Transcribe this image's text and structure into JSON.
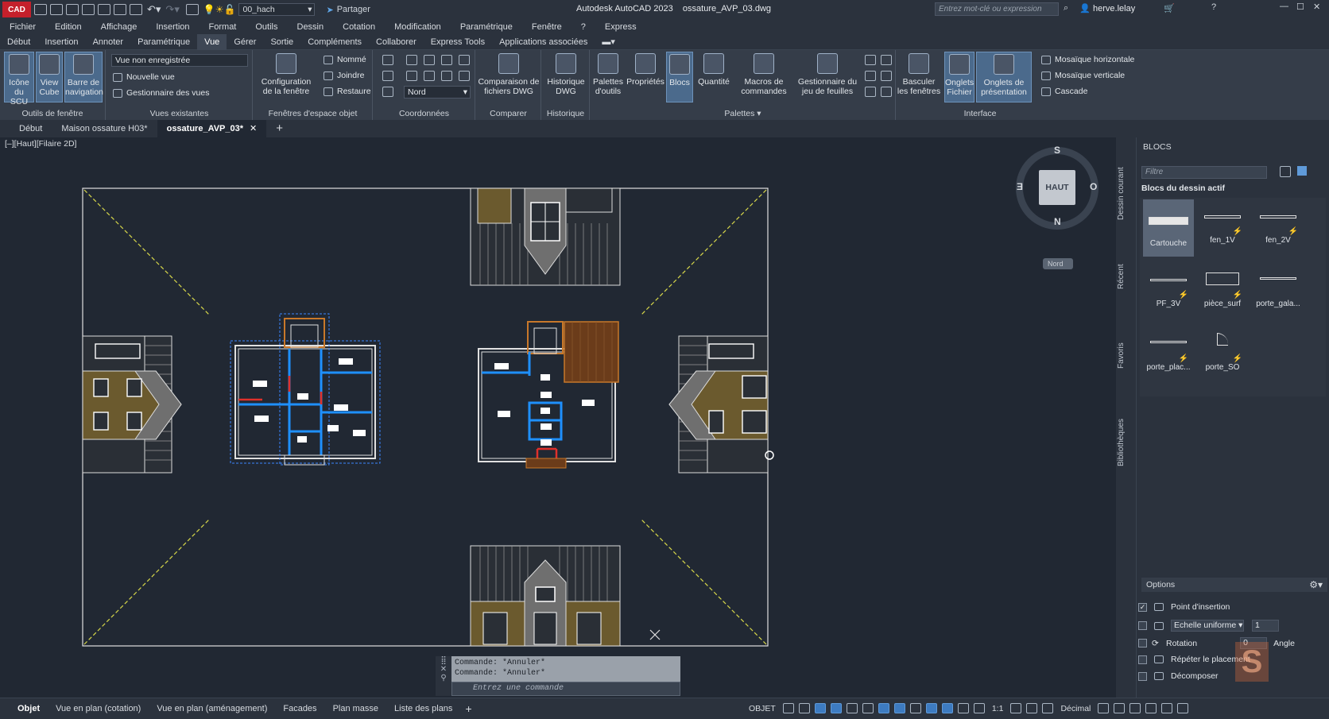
{
  "app": {
    "logo_text": "CAD",
    "window_title": "Autodesk AutoCAD 2023    ossature_AVP_03.dwg",
    "layer_combo": "00_hach",
    "share_label": "Partager",
    "search_placeholder": "Entrez mot-clé ou expression",
    "user_name": "herve.lelay"
  },
  "menu": [
    "Fichier",
    "Edition",
    "Affichage",
    "Insertion",
    "Format",
    "Outils",
    "Dessin",
    "Cotation",
    "Modification",
    "Paramétrique",
    "Fenêtre",
    "?",
    "Express"
  ],
  "ribbon_tabs": [
    "Début",
    "Insertion",
    "Annoter",
    "Paramétrique",
    "Vue",
    "Gérer",
    "Sortie",
    "Compléments",
    "Collaborer",
    "Express Tools",
    "Applications associées"
  ],
  "active_ribbon_tab": "Vue",
  "ribbon": {
    "outils_fenetre": {
      "title": "Outils de fenêtre",
      "btn1": "Icône du SCU",
      "btn2": "View Cube",
      "btn3": "Barre de navigation"
    },
    "vues_existantes": {
      "title": "Vues existantes",
      "combo": "Vue non enregistrée",
      "new_view": "Nouvelle vue",
      "manager": "Gestionnaire des vues"
    },
    "fenetres_objet": {
      "title": "Fenêtres d'espace objet",
      "config": "Configuration de la fenêtre",
      "named": "Nommé",
      "join": "Joindre",
      "restore": "Restaure"
    },
    "coordonnees": {
      "title": "Coordonnées",
      "combo": "Nord"
    },
    "comparer": {
      "title": "Comparer",
      "btn": "Comparaison de fichiers DWG"
    },
    "historique": {
      "title": "Historique",
      "btn": "Historique DWG"
    },
    "palettes": {
      "title": "Palettes",
      "tools": "Palettes d'outils",
      "props": "Propriétés",
      "blocks": "Blocs",
      "qty": "Quantité",
      "macros": "Macros de commandes",
      "sheetset": "Gestionnaire du jeu de feuilles"
    },
    "interface": {
      "title": "Interface",
      "switch": "Basculer les fenêtres",
      "file_tabs": "Onglets Fichier",
      "layout_tabs": "Onglets de présentation",
      "tile_h": "Mosaïque horizontale",
      "tile_v": "Mosaïque verticale",
      "cascade": "Cascade"
    }
  },
  "doc_tabs": [
    "Début",
    "Maison ossature H03*",
    "ossature_AVP_03*"
  ],
  "active_doc_tab": "ossature_AVP_03*",
  "viewport_label": "[–][Haut][Filaire 2D]",
  "viewcube": {
    "top": "HAUT",
    "n": "N",
    "s": "S",
    "e": "E",
    "o": "O",
    "wcs": "Nord"
  },
  "command": {
    "history": [
      "Commande: *Annuler*",
      "Commande: *Annuler*"
    ],
    "placeholder": "Entrez une commande"
  },
  "blocks_palette": {
    "title": "BLOCS",
    "filter_placeholder": "Filtre",
    "section": "Blocs du dessin actif",
    "side_tabs": [
      "Dessin courant",
      "Récent",
      "Favoris",
      "Bibliothèques"
    ],
    "items": [
      "Cartouche",
      "fen_1V",
      "fen_2V",
      "PF_3V",
      "pièce_surf",
      "porte_gala...",
      "porte_plac...",
      "porte_SO"
    ],
    "options_title": "Options",
    "options": {
      "insert_point": "Point d'insertion",
      "uniform_scale": "Echelle uniforme",
      "scale_value": "1",
      "rotation": "Rotation",
      "rotation_value": "0",
      "angle_label": "Angle",
      "repeat": "Répéter le placement",
      "explode": "Décomposer"
    }
  },
  "status_tabs": [
    "Objet",
    "Vue en plan (cotation)",
    "Vue en plan (aménagement)",
    "Facades",
    "Plan masse",
    "Liste des plans"
  ],
  "active_status_tab": "Objet",
  "status_right": {
    "space": "OBJET",
    "scale": "1:1",
    "units": "Décimal"
  },
  "colors": {
    "accent_blue": "#3d7bc1",
    "wall_blue": "#1e90ff",
    "door_red": "#e0302b",
    "wood_orange": "#c8782a",
    "guide_yellow": "#d9d94a"
  }
}
